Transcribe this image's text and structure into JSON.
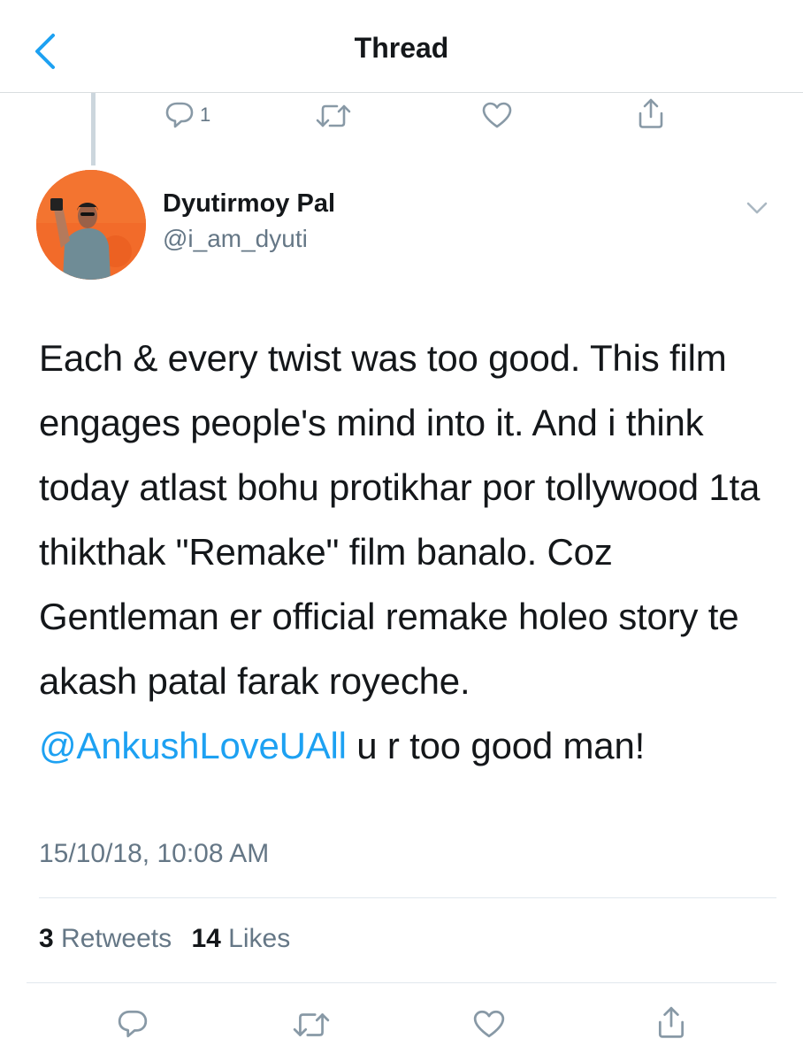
{
  "header": {
    "title": "Thread",
    "back_icon": "chevron-left-icon",
    "accent": "#1da1f2"
  },
  "previous_tweet_actions": {
    "reply_count": "1",
    "icons": [
      "reply-icon",
      "retweet-icon",
      "like-icon",
      "share-icon"
    ]
  },
  "tweet": {
    "author_name": "Dyutirmoy Pal",
    "author_handle": "@i_am_dyuti",
    "text_before_mention": "Each & every twist was too good. This film engages people's mind into it. And i think today atlast bohu protikhar por tollywood 1ta thikthak \"Remake\" film banalo. Coz Gentleman er official remake holeo story te akash patal farak royeche. ",
    "mention": "@AnkushLoveUAll",
    "text_after_mention": " u r too good man!",
    "timestamp": "15/10/18, 10:08 AM",
    "retweets_count": "3",
    "retweets_label": "Retweets",
    "likes_count": "14",
    "likes_label": "Likes"
  },
  "colors": {
    "text_primary": "#14171a",
    "text_secondary": "#657786",
    "link": "#1da1f2",
    "divider": "#e1e8ed"
  }
}
